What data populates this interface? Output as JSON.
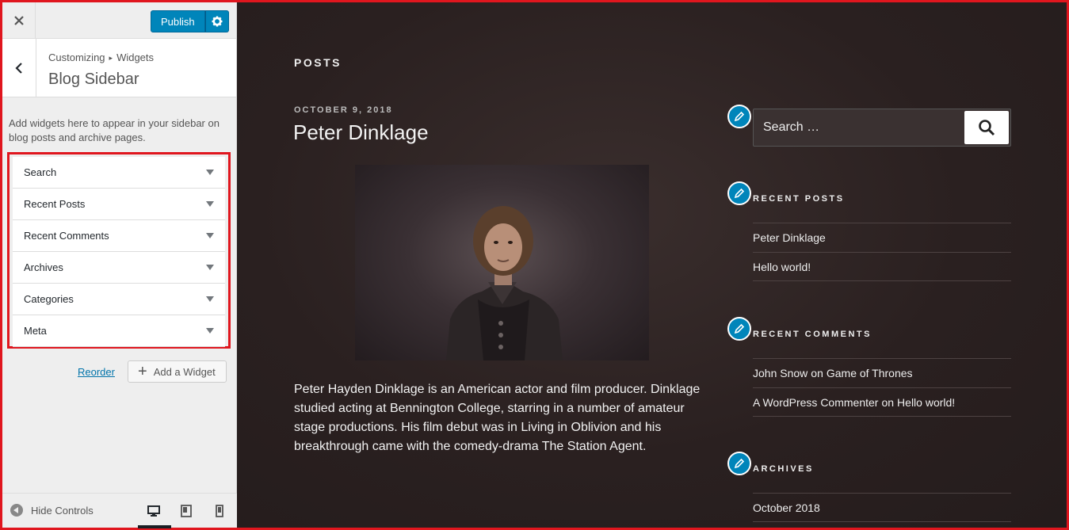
{
  "topbar": {
    "close_icon": "close-icon",
    "publish_label": "Publish",
    "settings_icon": "gear-icon"
  },
  "header": {
    "breadcrumb_root": "Customizing",
    "breadcrumb_child": "Widgets",
    "title": "Blog Sidebar"
  },
  "description": "Add widgets here to appear in your sidebar on blog posts and archive pages.",
  "widgets": [
    {
      "label": "Search"
    },
    {
      "label": "Recent Posts"
    },
    {
      "label": "Recent Comments"
    },
    {
      "label": "Archives"
    },
    {
      "label": "Categories"
    },
    {
      "label": "Meta"
    }
  ],
  "actions": {
    "reorder_label": "Reorder",
    "add_widget_label": "Add a Widget"
  },
  "footer": {
    "hide_controls_label": "Hide Controls",
    "devices": [
      "desktop-icon",
      "tablet-icon",
      "mobile-icon"
    ]
  },
  "preview": {
    "posts_heading": "POSTS",
    "post": {
      "date": "OCTOBER 9, 2018",
      "title": "Peter Dinklage",
      "text": "Peter Hayden Dinklage is an American actor and film producer. Dinklage studied acting at Bennington College, starring in a number of amateur stage productions. His film debut was in Living in Oblivion and his breakthrough came with the comedy-drama The Station Agent."
    },
    "sidebar": {
      "search_placeholder": "Search …",
      "recent_posts_title": "RECENT POSTS",
      "recent_posts": [
        "Peter Dinklage",
        "Hello world!"
      ],
      "recent_comments_title": "RECENT COMMENTS",
      "recent_comments": [
        {
          "author": "John Snow",
          "on": "on",
          "post": "Game of Thrones"
        },
        {
          "author": "A WordPress Commenter",
          "on": "on",
          "post": "Hello world!"
        }
      ],
      "archives_title": "ARCHIVES",
      "archives": [
        "October 2018"
      ]
    }
  },
  "colors": {
    "accent": "#0085ba",
    "highlight_border": "#e0161e",
    "preview_bg": "#2a2020"
  }
}
